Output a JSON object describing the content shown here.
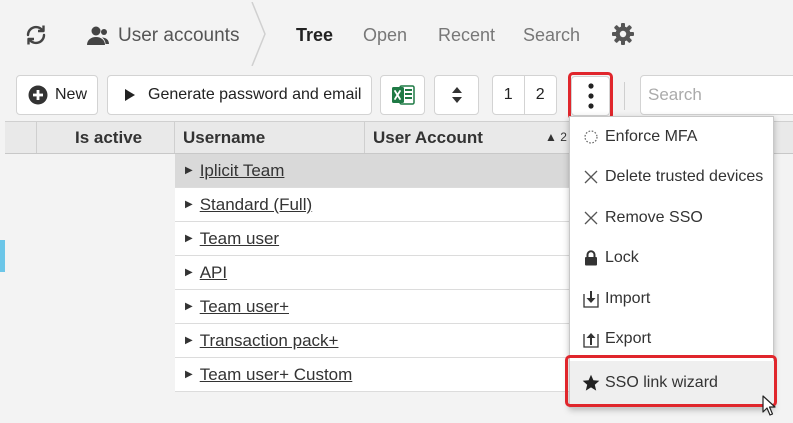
{
  "header": {
    "breadcrumb": "User accounts",
    "tabs": [
      {
        "label": "Tree",
        "active": true
      },
      {
        "label": "Open",
        "active": false
      },
      {
        "label": "Recent",
        "active": false
      },
      {
        "label": "Search",
        "active": false
      }
    ]
  },
  "toolbar": {
    "new_label": "New",
    "generate_label": "Generate password and email",
    "page_1": "1",
    "page_2": "2",
    "search_placeholder": "Search"
  },
  "grid": {
    "columns": [
      "Is active",
      "Username",
      "User Account"
    ],
    "sort_indicator": "▲ 2",
    "rows": [
      "Iplicit Team",
      "Standard (Full)",
      "Team user",
      "API",
      "Team user+",
      "Transaction pack+",
      "Team user+ Custom"
    ]
  },
  "menu": {
    "items": [
      {
        "label": "Enforce MFA",
        "icon": "spinner-icon"
      },
      {
        "label": "Delete trusted devices",
        "icon": "x-icon"
      },
      {
        "label": "Remove SSO",
        "icon": "x-icon"
      },
      {
        "label": "Lock",
        "icon": "lock-icon"
      },
      {
        "label": "Import",
        "icon": "import-icon"
      },
      {
        "label": "Export",
        "icon": "export-icon"
      },
      {
        "label": "SSO link wizard",
        "icon": "star-icon"
      }
    ]
  },
  "colors": {
    "highlight": "#e0262c",
    "excel_green": "#1f7a45",
    "active_rail": "#6cc6e8"
  }
}
